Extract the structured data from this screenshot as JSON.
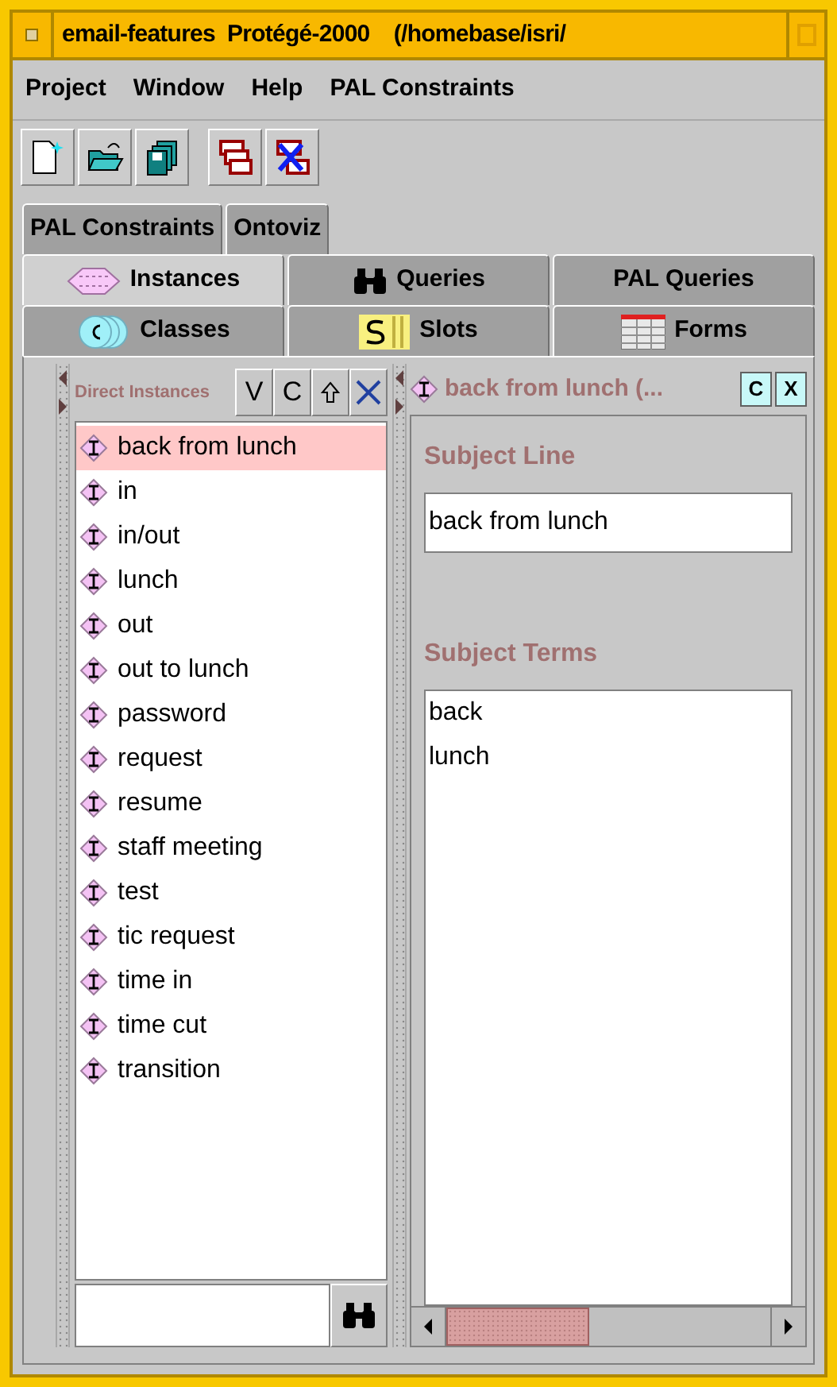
{
  "window": {
    "title": "email-features  Protégé-2000    (/homebase/isri/"
  },
  "menu": [
    "Project",
    "Window",
    "Help",
    "PAL Constraints"
  ],
  "tab_rows": [
    [
      {
        "label": "PAL Constraints",
        "selected": false
      },
      {
        "label": "Ontoviz",
        "selected": false
      }
    ],
    [
      {
        "label": "Instances",
        "selected": true
      },
      {
        "label": "Queries",
        "selected": false
      },
      {
        "label": "PAL Queries",
        "selected": false
      }
    ],
    [
      {
        "label": "Classes",
        "selected": false
      },
      {
        "label": "Slots",
        "selected": false
      },
      {
        "label": "Forms",
        "selected": false
      }
    ]
  ],
  "instances_panel": {
    "title": "Direct Instances",
    "buttons": [
      "V",
      "C"
    ],
    "items": [
      {
        "label": "back from lunch",
        "selected": true
      },
      {
        "label": "in",
        "selected": false
      },
      {
        "label": "in/out",
        "selected": false
      },
      {
        "label": "lunch",
        "selected": false
      },
      {
        "label": "out",
        "selected": false
      },
      {
        "label": "out to lunch",
        "selected": false
      },
      {
        "label": "password",
        "selected": false
      },
      {
        "label": "request",
        "selected": false
      },
      {
        "label": "resume",
        "selected": false
      },
      {
        "label": "staff meeting",
        "selected": false
      },
      {
        "label": "test",
        "selected": false
      },
      {
        "label": "tic request",
        "selected": false
      },
      {
        "label": "time in",
        "selected": false
      },
      {
        "label": "time cut",
        "selected": false
      },
      {
        "label": "transition",
        "selected": false
      }
    ]
  },
  "form_panel": {
    "title": "back from lunch (...",
    "buttons": [
      "C",
      "X"
    ],
    "subject_line": {
      "label": "Subject Line",
      "value": "back from lunch"
    },
    "subject_terms": {
      "label": "Subject Terms",
      "items": [
        "back",
        "lunch"
      ]
    }
  }
}
